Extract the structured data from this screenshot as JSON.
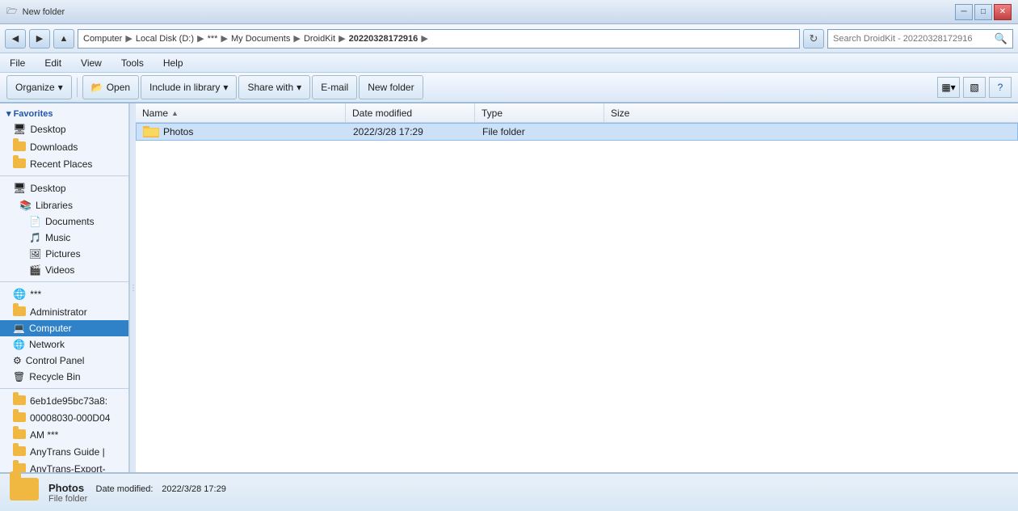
{
  "titlebar": {
    "title": "New folder",
    "minimize_label": "─",
    "maximize_label": "□",
    "close_label": "✕"
  },
  "addressbar": {
    "breadcrumb": "Computer ▶ Local Disk (D:) ▶ *** ▶ My Documents ▶ DroidKit ▶ 20220328172916",
    "refresh_icon": "↻",
    "search_placeholder": "Search DroidKit - 20220328172916"
  },
  "menu": {
    "items": [
      "File",
      "Edit",
      "View",
      "Tools",
      "Help"
    ]
  },
  "toolbar": {
    "organize_label": "Organize",
    "open_label": "Open",
    "include_label": "Include in library",
    "share_label": "Share with",
    "email_label": "E-mail",
    "newfolder_label": "New folder",
    "views_label": "▦",
    "pane_label": "▧",
    "help_label": "?"
  },
  "sidebar": {
    "favorites_header": "Favorites",
    "favorites_items": [
      {
        "id": "desktop",
        "label": "Desktop",
        "icon": "desktop"
      },
      {
        "id": "downloads",
        "label": "Downloads",
        "icon": "folder"
      },
      {
        "id": "recent",
        "label": "Recent Places",
        "icon": "folder"
      }
    ],
    "libraries_header": "Desktop",
    "libraries_sub": "Libraries",
    "lib_items": [
      {
        "id": "documents",
        "label": "Documents",
        "icon": "docs"
      },
      {
        "id": "music",
        "label": "Music",
        "icon": "music"
      },
      {
        "id": "pictures",
        "label": "Pictures",
        "icon": "pictures"
      },
      {
        "id": "videos",
        "label": "Videos",
        "icon": "video"
      }
    ],
    "other_items": [
      {
        "id": "homegroup",
        "label": "***",
        "icon": "folder-special"
      },
      {
        "id": "administrator",
        "label": "Administrator",
        "icon": "user-folder"
      },
      {
        "id": "computer",
        "label": "Computer",
        "icon": "computer",
        "selected": true
      },
      {
        "id": "network",
        "label": "Network",
        "icon": "network"
      },
      {
        "id": "controlpanel",
        "label": "Control Panel",
        "icon": "controlpanel"
      },
      {
        "id": "recycle",
        "label": "Recycle Bin",
        "icon": "recycle"
      },
      {
        "id": "folder1",
        "label": "6eb1de95bc73a8:",
        "icon": "folder"
      },
      {
        "id": "folder2",
        "label": "00008030-000D04",
        "icon": "folder"
      },
      {
        "id": "folder3",
        "label": "AM ***",
        "icon": "folder"
      },
      {
        "id": "folder4",
        "label": "AnyTrans Guide |",
        "icon": "folder"
      },
      {
        "id": "folder5",
        "label": "AnyTrans-Export-",
        "icon": "folder"
      }
    ]
  },
  "columns": {
    "name": "Name",
    "date_modified": "Date modified",
    "type": "Type",
    "size": "Size"
  },
  "files": [
    {
      "name": "Photos",
      "date_modified": "2022/3/28 17:29",
      "type": "File folder",
      "size": "",
      "icon": "folder",
      "selected": true
    }
  ],
  "statusbar": {
    "item_name": "Photos",
    "date_label": "Date modified:",
    "date_value": "2022/3/28 17:29",
    "type_value": "File folder"
  }
}
